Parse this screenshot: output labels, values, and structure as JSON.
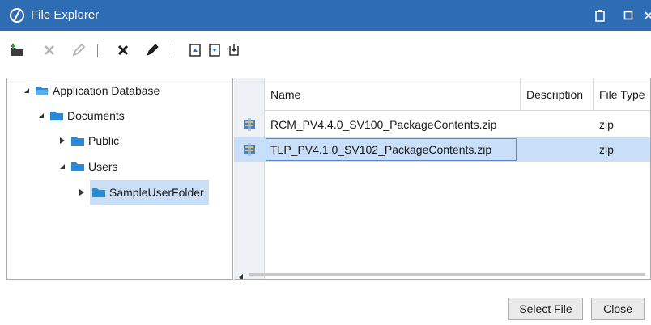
{
  "window": {
    "title": "File Explorer",
    "accent_color": "#2e6db4",
    "controls": [
      "clipboard-icon",
      "restore-icon",
      "close-icon"
    ]
  },
  "toolbar": {
    "buttons": [
      "new-folder-icon",
      "delete-folder-icon",
      "rename-folder-icon",
      "delete-file-icon",
      "rename-file-icon",
      "import-icon",
      "export-icon",
      "download-icon"
    ]
  },
  "tree": {
    "nodes": [
      {
        "label": "Application Database",
        "level": 0,
        "expanded": true
      },
      {
        "label": "Documents",
        "level": 1,
        "expanded": true
      },
      {
        "label": "Public",
        "level": 2,
        "expanded": false
      },
      {
        "label": "Users",
        "level": 2,
        "expanded": true
      },
      {
        "label": "SampleUserFolder",
        "level": 3,
        "expanded": false,
        "selected": true
      }
    ]
  },
  "file_list": {
    "columns": [
      "Name",
      "Description",
      "File Type"
    ],
    "rows": [
      {
        "name": "RCM_PV4.4.0_SV100_PackageContents.zip",
        "description": "",
        "file_type": "zip",
        "selected": false
      },
      {
        "name": "TLP_PV4.1.0_SV102_PackageContents.zip",
        "description": "",
        "file_type": "zip",
        "selected": true
      }
    ]
  },
  "footer": {
    "select_label": "Select File",
    "close_label": "Close"
  },
  "colors": {
    "selection": "#c9dff7",
    "folder": "#2a8ad6"
  }
}
